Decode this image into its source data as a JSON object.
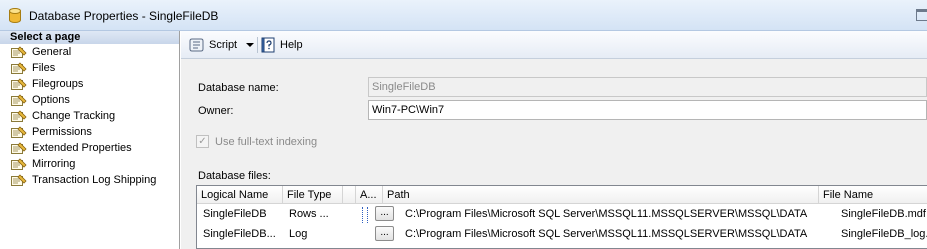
{
  "window": {
    "title": "Database Properties - SingleFileDB"
  },
  "sidebar": {
    "header": "Select a page",
    "items": [
      {
        "label": "General"
      },
      {
        "label": "Files"
      },
      {
        "label": "Filegroups"
      },
      {
        "label": "Options"
      },
      {
        "label": "Change Tracking"
      },
      {
        "label": "Permissions"
      },
      {
        "label": "Extended Properties"
      },
      {
        "label": "Mirroring"
      },
      {
        "label": "Transaction Log Shipping"
      }
    ]
  },
  "toolbar": {
    "script_label": "Script",
    "help_label": "Help"
  },
  "form": {
    "database_name_label": "Database name:",
    "database_name_value": "SingleFileDB",
    "owner_label": "Owner:",
    "owner_value": "Win7-PC\\Win7",
    "fulltext_label": "Use full-text indexing",
    "fulltext_checked": true,
    "database_files_label": "Database files:"
  },
  "files_grid": {
    "columns": [
      "Logical Name",
      "File Type",
      "A...",
      "Path",
      "File Name"
    ],
    "rows": [
      {
        "logical_name": "SingleFileDB",
        "file_type": "Rows ...",
        "button": "...",
        "path": "C:\\Program Files\\Microsoft SQL Server\\MSSQL11.MSSQLSERVER\\MSSQL\\DATA",
        "file_name": "SingleFileDB.mdf"
      },
      {
        "logical_name": "SingleFileDB...",
        "file_type": "Log",
        "button": "...",
        "path": "C:\\Program Files\\Microsoft SQL Server\\MSSQL11.MSSQLSERVER\\MSSQL\\DATA",
        "file_name": "SingleFileDB_log.ldf"
      }
    ]
  },
  "colors": {
    "titlebar": "#d4e3f5",
    "panel_bg": "#f0f0f0",
    "grid_border": "#828790"
  }
}
